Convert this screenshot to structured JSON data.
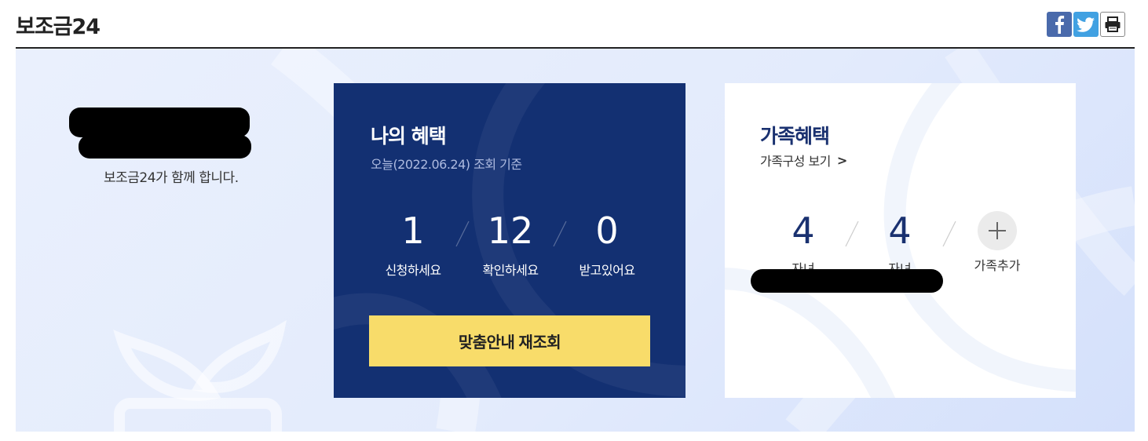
{
  "header": {
    "title": "보조금24",
    "share": {
      "facebook_icon": "facebook-icon",
      "twitter_icon": "twitter-icon",
      "print_icon": "print-icon"
    }
  },
  "welcome": {
    "text": "보조금24가 함께 합니다."
  },
  "my_benefits": {
    "title": "나의 혜택",
    "date_text": "오늘(2022.06.24) 조회 기준",
    "stats": [
      {
        "value": "1",
        "label": "신청하세요"
      },
      {
        "value": "12",
        "label": "확인하세요"
      },
      {
        "value": "0",
        "label": "받고있어요"
      }
    ],
    "recheck_button": "맞춤안내 재조회"
  },
  "family_benefits": {
    "title": "가족혜택",
    "link_text": "가족구성 보기",
    "link_arrow": ">",
    "members": [
      {
        "value": "4",
        "label": "자녀"
      },
      {
        "value": "4",
        "label": "자녀"
      }
    ],
    "add_label": "가족추가"
  },
  "colors": {
    "navy": "#133072",
    "yellow": "#f8dc6a",
    "accent_text": "#1a3170",
    "banner_bg": "#e3ebfc"
  }
}
